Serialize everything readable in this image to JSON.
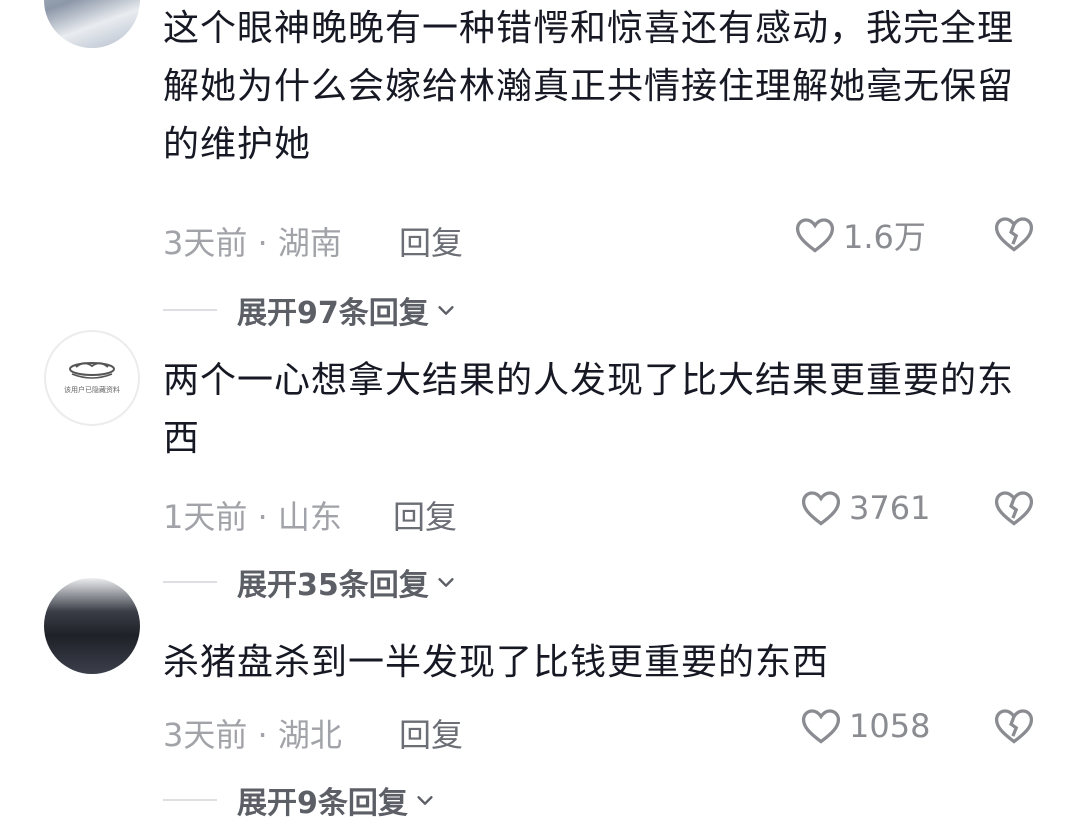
{
  "comments": [
    {
      "text": "这个眼神晚晚有一种错愕和惊喜还有感动，我完全理解她为什么会嫁给林瀚真正共情接住理解她毫无保留的维护她",
      "time_location": "3天前 · 湖南",
      "reply_label": "回复",
      "likes": "1.6万",
      "expand_label": "展开97条回复",
      "avatar_icon": "user-avatar-photo"
    },
    {
      "text": "两个一心想拿大结果的人发现了比大结果更重要的东西",
      "time_location": "1天前 · 山东",
      "reply_label": "回复",
      "likes": "3761",
      "expand_label": "展开35条回复",
      "avatar_icon": "user-avatar-logo",
      "avatar_caption": "该用户已隐藏资料"
    },
    {
      "text": "杀猪盘杀到一半发现了比钱更重要的东西",
      "time_location": "3天前 · 湖北",
      "reply_label": "回复",
      "likes": "1058",
      "expand_label": "展开9条回复",
      "avatar_icon": "user-avatar-photo"
    }
  ],
  "colors": {
    "text": "#161823",
    "meta": "#a1a3a8",
    "expand": "#5c5f66"
  }
}
